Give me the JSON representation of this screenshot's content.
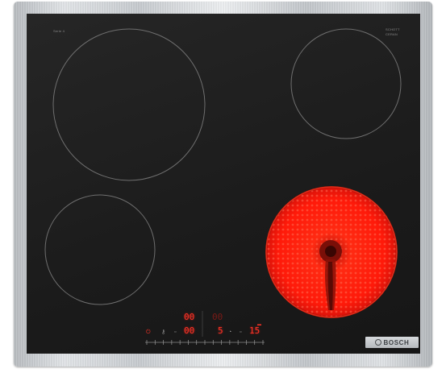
{
  "brand": "BOSCH",
  "model_mark": "Serie 4",
  "rating_lines": [
    "SCHOTT",
    "CERAN"
  ],
  "colors": {
    "glass": "#1b1b1b",
    "frame": "#d4d7da",
    "ring": "#6f6f6f",
    "heat": "#ff1a0a",
    "display": "#ff3326"
  },
  "zones": [
    {
      "name": "rear-left",
      "state": "off"
    },
    {
      "name": "rear-right",
      "state": "off"
    },
    {
      "name": "front-left",
      "state": "off"
    },
    {
      "name": "front-right",
      "state": "on-glowing"
    }
  ],
  "controls": {
    "rear_left_display": "00",
    "rear_right_display": "00",
    "front_left_display": "00",
    "front_right_display": "5",
    "timer_display": "15",
    "slider_levels": 15
  }
}
